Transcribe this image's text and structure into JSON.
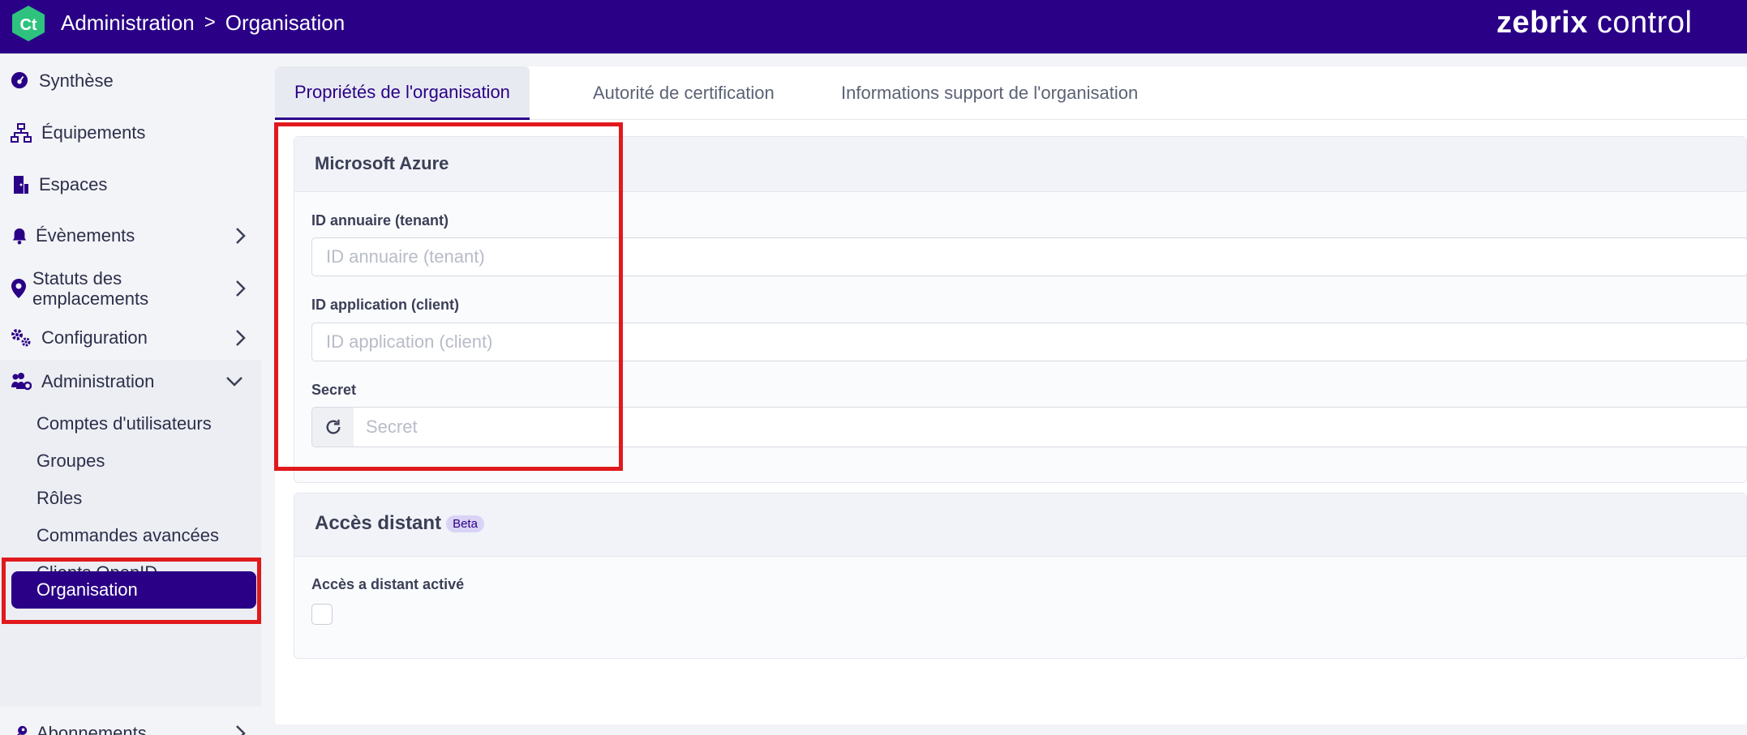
{
  "header": {
    "logo_text": "Ct",
    "breadcrumb": [
      "Administration",
      "Organisation"
    ],
    "breadcrumb_separator": ">",
    "brand_bold": "zebrix",
    "brand_rest": " control"
  },
  "sidebar": {
    "items": [
      {
        "label": "Synthèse",
        "icon": "dashboard-icon"
      },
      {
        "label": "Équipements",
        "icon": "network-icon"
      },
      {
        "label": "Espaces",
        "icon": "door-icon"
      },
      {
        "label": "Évènements",
        "icon": "bell-icon",
        "has_chevron": true
      },
      {
        "label": "Statuts des emplacements",
        "icon": "location-pin-icon",
        "has_chevron": true
      },
      {
        "label": "Configuration",
        "icon": "gears-icon",
        "has_chevron": true
      },
      {
        "label": "Administration",
        "icon": "users-gear-icon",
        "expanded": true
      },
      {
        "label": "Abonnements",
        "icon": "key-icon",
        "has_chevron": true
      }
    ],
    "sub_items": [
      "Comptes d'utilisateurs",
      "Groupes",
      "Rôles",
      "Commandes avancées",
      "Clients OpenID Connect",
      "Organisation"
    ],
    "active_sub_item": "Organisation"
  },
  "tabs": [
    {
      "label": "Propriétés de l'organisation",
      "active": true
    },
    {
      "label": "Autorité de certification",
      "active": false
    },
    {
      "label": "Informations support de l'organisation",
      "active": false
    }
  ],
  "azure": {
    "title": "Microsoft Azure",
    "tenant_label": "ID annuaire (tenant)",
    "tenant_placeholder": "ID annuaire (tenant)",
    "client_label": "ID application (client)",
    "client_placeholder": "ID application (client)",
    "secret_label": "Secret",
    "secret_placeholder": "Secret"
  },
  "remote": {
    "title": "Accès distant",
    "badge": "Beta",
    "enabled_label": "Accès a distant activé",
    "enabled": false
  },
  "colors": {
    "primary": "#2a0086",
    "logo_green": "#2ec27e",
    "highlight_red": "#e0191d"
  }
}
